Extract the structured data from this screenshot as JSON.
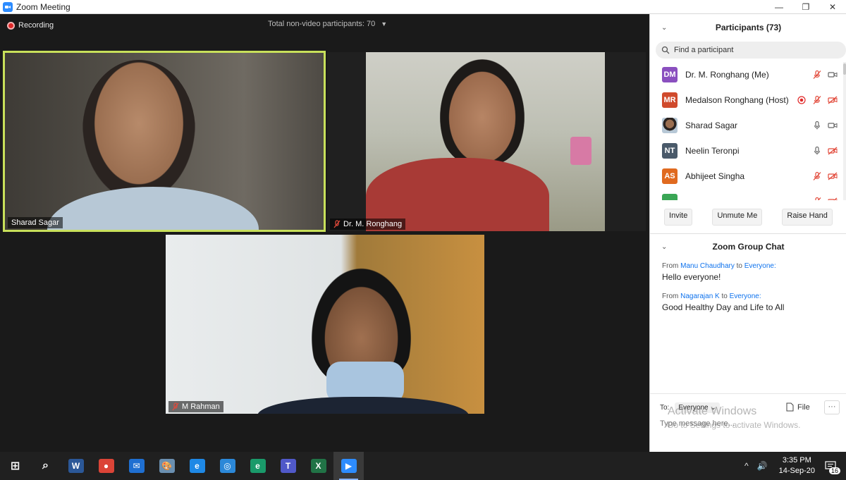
{
  "window": {
    "title": "Zoom Meeting"
  },
  "colors": {
    "accent": "#0e72ed",
    "active_speaker": "#c8e05a",
    "recording": "#e02828"
  },
  "meeting": {
    "recording_label": "Recording",
    "nonvideo_label": "Total non-video participants: 70"
  },
  "tiles": [
    {
      "name": "Sharad Sagar",
      "muted": false,
      "active": true
    },
    {
      "name": "Dr. M. Ronghang",
      "muted": true,
      "active": false
    },
    {
      "name": "M Rahman",
      "muted": true,
      "active": false
    }
  ],
  "participants": {
    "title": "Participants (73)",
    "search_placeholder": "Find a participant",
    "items": [
      {
        "initials": "DM",
        "name": "Dr. M. Ronghang (Me)",
        "color": "#8a4fbf",
        "mic": "muted",
        "video": "on",
        "recording": false
      },
      {
        "initials": "MR",
        "name": "Medalson Ronghang (Host)",
        "color": "#d04a2c",
        "mic": "muted",
        "video": "off",
        "recording": true
      },
      {
        "initials": "",
        "name": "Sharad Sagar",
        "color": "#3b3b3b",
        "mic": "on",
        "video": "on",
        "recording": false,
        "photo": true
      },
      {
        "initials": "NT",
        "name": "Neelin Teronpi",
        "color": "#4a5a6a",
        "mic": "on",
        "video": "off",
        "recording": false
      },
      {
        "initials": "AS",
        "name": "Abhijeet Singha",
        "color": "#e06a1f",
        "mic": "muted",
        "video": "off",
        "recording": false
      },
      {
        "initials": "",
        "name": "",
        "color": "#3aa655",
        "mic": "muted",
        "video": "off",
        "recording": false
      }
    ],
    "buttons": {
      "invite": "Invite",
      "unmute": "Unmute Me",
      "raise_hand": "Raise Hand"
    }
  },
  "chat": {
    "title": "Zoom Group Chat",
    "messages": [
      {
        "from_prefix": "From",
        "sender": "Manu Chaudhary",
        "to_word": "to",
        "recipient": "Everyone:",
        "text": "Hello everyone!"
      },
      {
        "from_prefix": "From",
        "sender": "Nagarajan K",
        "to_word": "to",
        "recipient": "Everyone:",
        "text": "Good Healthy Day and Life to All"
      }
    ],
    "to_label": "To:",
    "to_value": "Everyone",
    "file_label": "File",
    "more_label": "···",
    "input_placeholder": "Type message here..."
  },
  "watermark": {
    "line1": "Activate Windows",
    "line2": "Go to Settings to activate Windows."
  },
  "taskbar": {
    "apps": [
      {
        "name": "start",
        "label": "⊞",
        "color": "transparent"
      },
      {
        "name": "search",
        "label": "⌕",
        "color": "transparent"
      },
      {
        "name": "word",
        "label": "W",
        "color": "#2b5797"
      },
      {
        "name": "chrome",
        "label": "●",
        "color": "#db4437"
      },
      {
        "name": "mail",
        "label": "✉",
        "color": "#1f6fd1"
      },
      {
        "name": "paint",
        "label": "🎨",
        "color": "#6a8fb0"
      },
      {
        "name": "ie",
        "label": "e",
        "color": "#1e88e5"
      },
      {
        "name": "safari",
        "label": "◎",
        "color": "#2b88d8"
      },
      {
        "name": "edge",
        "label": "e",
        "color": "#1a9a6a"
      },
      {
        "name": "teams",
        "label": "T",
        "color": "#5059c9"
      },
      {
        "name": "excel",
        "label": "X",
        "color": "#217346"
      },
      {
        "name": "zoom",
        "label": "▶",
        "color": "#2d8cff"
      }
    ],
    "time": "3:35 PM",
    "date": "14-Sep-20",
    "notification_count": "16",
    "tray_chevron": "^",
    "tray_volume": "🔊"
  }
}
